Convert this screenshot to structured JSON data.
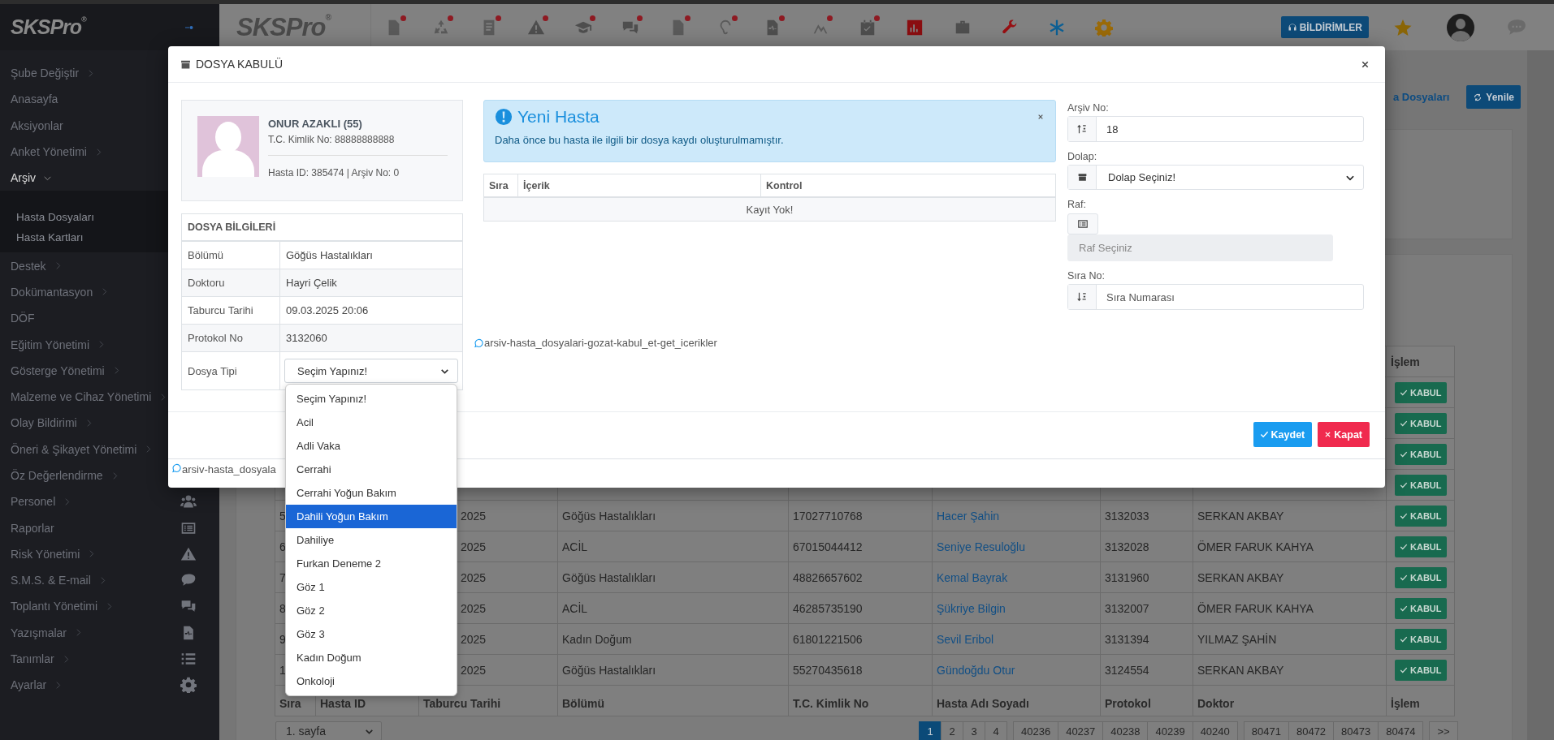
{
  "sidebar": {
    "logo": "SKSPro$^{®}$",
    "items": [
      {
        "label": "Şube Değiştir",
        "kind": "group",
        "expanded": false,
        "icon": false
      },
      {
        "label": "Anasayfa",
        "kind": "link",
        "expanded": false,
        "icon": false
      },
      {
        "label": "Aksiyonlar",
        "kind": "link",
        "expanded": false,
        "icon": false
      },
      {
        "label": "Anket Yönetimi",
        "kind": "group",
        "expanded": false,
        "icon": false
      },
      {
        "label": "Arşiv",
        "kind": "group",
        "expanded": true,
        "icon": false,
        "children": [
          {
            "label": "Hasta Dosyaları"
          },
          {
            "label": "Hasta Kartları"
          }
        ]
      },
      {
        "label": "Destek",
        "kind": "group",
        "expanded": false,
        "icon": false
      },
      {
        "label": "Dokümantasyon",
        "kind": "group",
        "expanded": false,
        "icon": false
      },
      {
        "label": "DÖF",
        "kind": "link",
        "expanded": false,
        "icon": false
      },
      {
        "label": "Eğitim Yönetimi",
        "kind": "group",
        "expanded": false,
        "icon": false
      },
      {
        "label": "Gösterge Yönetimi",
        "kind": "group",
        "expanded": false,
        "icon": false
      },
      {
        "label": "Malzeme ve Cihaz Yönetimi",
        "kind": "group",
        "expanded": false,
        "icon": false
      },
      {
        "label": "Olay Bildirimi",
        "kind": "group",
        "expanded": false,
        "icon": false
      },
      {
        "label": "Öneri & Şikayet Yönetimi",
        "kind": "group",
        "expanded": false,
        "icon": false
      },
      {
        "label": "Öz Değerlendirme",
        "kind": "group",
        "expanded": false,
        "icon": false
      },
      {
        "label": "Personel",
        "kind": "group",
        "expanded": false,
        "icon": true
      },
      {
        "label": "Raporlar",
        "kind": "link",
        "expanded": false,
        "icon": true
      },
      {
        "label": "Risk Yönetimi",
        "kind": "group",
        "expanded": false,
        "icon": true
      },
      {
        "label": "S.M.S. & E-mail",
        "kind": "group",
        "expanded": false,
        "icon": true
      },
      {
        "label": "Toplantı Yönetimi",
        "kind": "group",
        "expanded": false,
        "icon": true
      },
      {
        "label": "Yazışmalar",
        "kind": "group",
        "expanded": false,
        "icon": true
      },
      {
        "label": "Tanımlar",
        "kind": "group",
        "expanded": false,
        "icon": true
      },
      {
        "label": "Ayarlar",
        "kind": "group",
        "expanded": false,
        "icon": true
      }
    ]
  },
  "header": {
    "logo": "SKSPro$^{®}$",
    "toolbar": [
      {
        "dot": true
      },
      {
        "dot": true
      },
      {
        "dot": true
      },
      {
        "dot": true
      },
      {
        "dot": true
      },
      {
        "dot": true
      },
      {
        "dot": true
      },
      {
        "dot": true
      },
      {
        "dot": true
      },
      {
        "dot": true
      },
      {
        "dot": true
      },
      {
        "dot": false
      },
      {
        "dot": false
      },
      {
        "dot": false
      },
      {
        "dot": false
      },
      {
        "dot": false
      }
    ],
    "notifications_button": "BİLDİRİMLER"
  },
  "page": {
    "link": "a Dosyaları",
    "refresh_button": "Yenile",
    "table": {
      "header_action": "İşlem",
      "rows": [
        {
          "action": "KABUL"
        },
        {
          "action": "KABUL"
        },
        {
          "action": "KABUL"
        },
        {
          "action": "KABUL"
        },
        {
          "cells": [
            "5",
            "2025",
            "Göğüs Hastalıkları",
            "17027710768",
            "Hacer Şahin",
            "3132033",
            "SERKAN AKBAY"
          ],
          "action": "KABUL"
        },
        {
          "cells": [
            "6",
            "2025",
            "ACİL",
            "67015044412",
            "Seniye Resuloğlu",
            "3132028",
            "ÖMER FARUK KAHYA"
          ],
          "action": "KABUL"
        },
        {
          "cells": [
            "7",
            "2025",
            "Göğüs Hastalıkları",
            "48826657602",
            "Kemal Bayrak",
            "3131960",
            "SERKAN AKBAY"
          ],
          "action": "KABUL"
        },
        {
          "cells": [
            "8",
            "2025",
            "ACİL",
            "46285735190",
            "Şükriye Bilgin",
            "3132007",
            "ÖMER FARUK KAHYA"
          ],
          "action": "KABUL"
        },
        {
          "cells": [
            "9",
            "2025",
            "Kadın Doğum",
            "61801221506",
            "Sevil Eribol",
            "3131394",
            "YILMAZ ŞAHİN"
          ],
          "action": "KABUL"
        },
        {
          "cells": [
            "1",
            "2025",
            "Göğüs Hastalıkları",
            "55270435618",
            "Gündoğdu Otur",
            "3124554",
            "SERKAN AKBAY"
          ],
          "action": "KABUL"
        }
      ],
      "footer": [
        "Sıra",
        "Hasta ID",
        "Taburcu Tarihi",
        "Bölümü",
        "T.C. Kimlik No",
        "Hasta Adı Soyadı",
        "Protokol",
        "Doktor",
        "İşlem"
      ]
    },
    "pagination": {
      "page_select": "1. sayfa",
      "groups": [
        [
          {
            "label": "1",
            "selected": true
          },
          {
            "label": "2",
            "selected": false
          },
          {
            "label": "3",
            "selected": false
          },
          {
            "label": "4",
            "selected": false
          }
        ],
        [
          {
            "label": "40236",
            "selected": false
          },
          {
            "label": "40237",
            "selected": false
          },
          {
            "label": "40238",
            "selected": false
          },
          {
            "label": "40239",
            "selected": false
          },
          {
            "label": "40240",
            "selected": false
          }
        ],
        [
          {
            "label": "80471",
            "selected": false
          },
          {
            "label": "80472",
            "selected": false
          },
          {
            "label": "80473",
            "selected": false
          },
          {
            "label": "80474",
            "selected": false
          }
        ],
        [
          {
            "label": ">>",
            "selected": false
          }
        ]
      ]
    }
  },
  "modal": {
    "title": "DOSYA KABULÜ",
    "patient": {
      "name": "ONUR AZAKLI (55)",
      "id_line": "T.C. Kimlik No: 88888888888",
      "meta": "Hasta ID: 385474 | Arşiv No: 0"
    },
    "file_info": {
      "title": "DOSYA BİLGİLERİ",
      "rows": [
        {
          "label": "Bölümü",
          "kind": "text",
          "value": "Göğüs Hastalıkları"
        },
        {
          "label": "Doktoru",
          "kind": "text",
          "value": "Hayri Çelik"
        },
        {
          "label": "Taburcu Tarihi",
          "kind": "text",
          "value": "09.03.2025 20:06"
        },
        {
          "label": "Protokol No",
          "kind": "text",
          "value": "3132060"
        },
        {
          "label": "Dosya Tipi",
          "kind": "select",
          "value": "Seçim Yapınız!"
        }
      ]
    },
    "file_type_options": [
      {
        "label": "Seçim Yapınız!",
        "selected": false
      },
      {
        "label": "Acil",
        "selected": false
      },
      {
        "label": "Adli Vaka",
        "selected": false
      },
      {
        "label": "Cerrahi",
        "selected": false
      },
      {
        "label": "Cerrahi Yoğun Bakım",
        "selected": false
      },
      {
        "label": "Dahili Yoğun Bakım",
        "selected": true
      },
      {
        "label": "Dahiliye",
        "selected": false
      },
      {
        "label": "Furkan Deneme 2",
        "selected": false
      },
      {
        "label": "Göz 1",
        "selected": false
      },
      {
        "label": "Göz 2",
        "selected": false
      },
      {
        "label": "Göz 3",
        "selected": false
      },
      {
        "label": "Kadın Doğum",
        "selected": false
      },
      {
        "label": "Onkoloji",
        "selected": false
      }
    ],
    "alert": {
      "title": "Yeni Hasta",
      "message": "Daha önce bu hasta ile ilgili bir dosya kaydı oluşturulmamıştır."
    },
    "contents_table": {
      "columns": [
        "Sıra",
        "İçerik",
        "Kontrol"
      ],
      "empty": "Kayıt Yok!"
    },
    "debug_key": "arsiv-hasta_dosyalari-gozat-kabul_et-get_icerikler",
    "form": {
      "archive_no": {
        "label": "Arşiv No:",
        "value": "18"
      },
      "cabinet": {
        "label": "Dolap:",
        "value": "Dolap Seçiniz!"
      },
      "shelf": {
        "label": "Raf:",
        "placeholder": "Raf Seçiniz",
        "disabled": true
      },
      "order_no": {
        "label": "Sıra No:",
        "placeholder": "Sıra Numarası"
      }
    },
    "buttons": {
      "save": "Kaydet",
      "close": "Kapat"
    },
    "footer_key": "arsiv-hasta_dosyala"
  }
}
